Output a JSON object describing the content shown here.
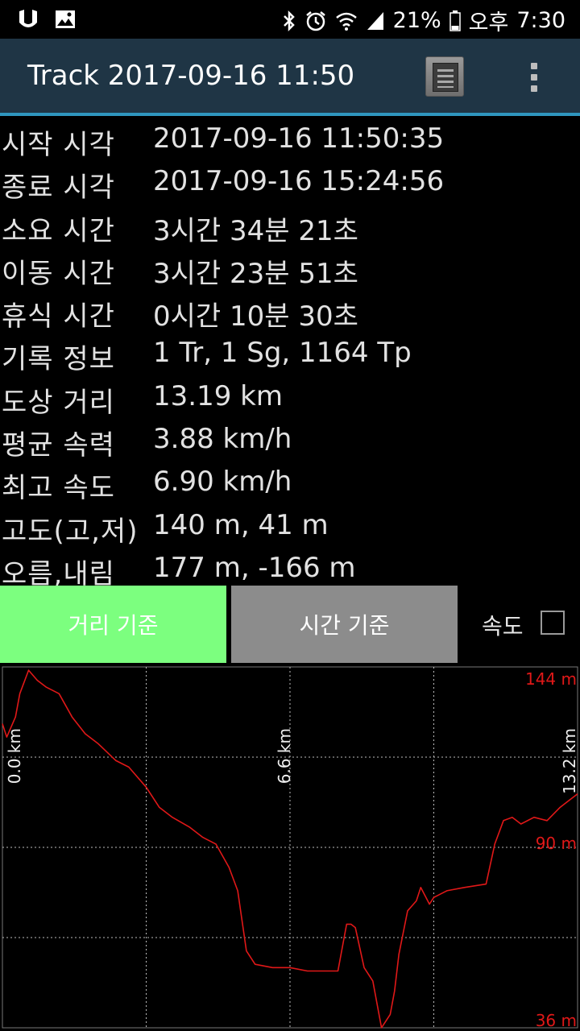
{
  "status_bar": {
    "battery": "21%",
    "ampm": "오후",
    "time": "7:30"
  },
  "action_bar": {
    "title": "Track 2017-09-16 11:50"
  },
  "info_rows": [
    {
      "label": "시작 시각",
      "value": "2017-09-16 11:50:35"
    },
    {
      "label": "종료 시각",
      "value": "2017-09-16 15:24:56"
    },
    {
      "label": "소요 시간",
      "value": "3시간 34분 21초"
    },
    {
      "label": "이동 시간",
      "value": "3시간 23분 51초"
    },
    {
      "label": "휴식 시간",
      "value": "0시간 10분 30초"
    },
    {
      "label": "기록 정보",
      "value": "1 Tr, 1 Sg, 1164 Tp"
    },
    {
      "label": "도상 거리",
      "value": "13.19 km"
    },
    {
      "label": "평균 속력",
      "value": "3.88 km/h"
    },
    {
      "label": "최고 속도",
      "value": "6.90 km/h"
    },
    {
      "label": "고도(고,저)",
      "value": "140 m, 41 m"
    },
    {
      "label": "오름,내림",
      "value": "177 m, -166 m"
    }
  ],
  "tabs": {
    "distance_label": "거리 기준",
    "time_label": "시간 기준",
    "speed_label": "속도",
    "speed_checked": false
  },
  "colors": {
    "accent": "#2f96bf",
    "tab_active": "#7cff7f",
    "tab_inactive": "#8c8c8c",
    "line": "#e01818"
  },
  "chart_data": {
    "type": "line",
    "title": "",
    "xlabel": "",
    "ylabel": "",
    "x_tick_labels": [
      "0.0 km",
      "6.6 km",
      "13.2 km"
    ],
    "y_tick_labels": [
      "144 m",
      "90 m",
      "36 m"
    ],
    "xlim": [
      0,
      13.2
    ],
    "ylim": [
      36,
      144
    ],
    "grid": true,
    "series": [
      {
        "x": [
          0,
          0.1,
          0.3,
          0.4,
          0.6,
          0.8,
          1.0,
          1.3,
          1.6,
          1.9,
          2.2,
          2.6,
          2.9,
          3.3,
          3.6,
          3.9,
          4.3,
          4.6,
          4.9,
          5.2,
          5.4,
          5.5,
          5.6,
          5.8,
          6.2,
          6.6,
          7.0,
          7.4,
          7.6,
          7.7,
          7.9,
          8.0,
          8.1,
          8.3,
          8.5,
          8.6,
          8.7,
          8.9,
          9.0,
          9.1,
          9.3,
          9.5,
          9.6,
          9.8,
          9.9,
          10.2,
          10.6,
          11.1,
          11.3,
          11.5,
          11.7,
          11.9,
          12.2,
          12.5,
          12.8,
          13.0,
          13.2
        ],
        "y": [
          127,
          123,
          129,
          136,
          143,
          140,
          138,
          136,
          129,
          124,
          121,
          116,
          114,
          108,
          102,
          99,
          96,
          93,
          91,
          84,
          77,
          68,
          59,
          55,
          54,
          54,
          53,
          53,
          53,
          53,
          67,
          67,
          66,
          54,
          50,
          43,
          36,
          40,
          47,
          58,
          71,
          74,
          78,
          73,
          75,
          77,
          78,
          79,
          91,
          98,
          99,
          97,
          99,
          98,
          102,
          104,
          106
        ]
      }
    ]
  }
}
